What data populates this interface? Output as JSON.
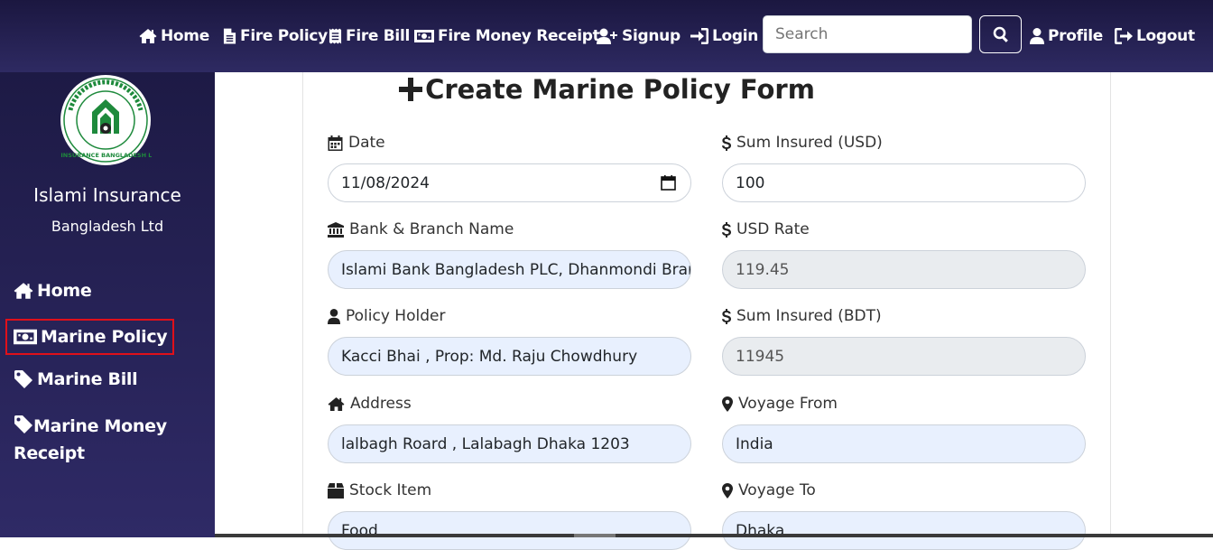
{
  "topnav": {
    "home": "Home",
    "fire_policy": "Fire Policy",
    "fire_bill": "Fire Bill",
    "fire_money_receipt": "Fire Money Receipt",
    "signup": "Signup",
    "login": "Login",
    "search_placeholder": "Search",
    "profile": "Profile",
    "logout": "Logout"
  },
  "sidebar": {
    "brand_name": "Islami Insurance",
    "brand_sub": "Bangladesh Ltd",
    "logo_text": "ISLAMI INSURANCE BANGLADESH LIMITED",
    "items": [
      {
        "label": "Home"
      },
      {
        "label": "Marine Policy"
      },
      {
        "label": "Marine Bill"
      },
      {
        "label": "Marine Money Receipt"
      }
    ]
  },
  "form": {
    "title": "Create Marine Policy Form",
    "date_label": "Date",
    "date_value": "11/08/2024",
    "sum_insured_usd_label": "Sum Insured (USD)",
    "sum_insured_usd_value": "100",
    "bank_label": "Bank & Branch Name",
    "bank_value": "Islami Bank Bangladesh PLC, Dhanmondi Branch",
    "usd_rate_label": "USD Rate",
    "usd_rate_value": "119.45",
    "policy_holder_label": "Policy Holder",
    "policy_holder_value": "Kacci Bhai , Prop: Md. Raju Chowdhury",
    "sum_insured_bdt_label": "Sum Insured (BDT)",
    "sum_insured_bdt_value": "11945",
    "address_label": "Address",
    "address_value": "lalbagh Roard , Lalabagh Dhaka 1203",
    "voyage_from_label": "Voyage From",
    "voyage_from_value": "India",
    "stock_item_label": "Stock Item",
    "stock_item_value": "Food",
    "voyage_to_label": "Voyage To",
    "voyage_to_value": "Dhaka"
  },
  "colors": {
    "nav_bg": "#1b1740",
    "sidebar_bg": "#2f2a66",
    "active_outline": "#e0101a",
    "autofill_bg": "#e8f0fe",
    "disabled_bg": "#e9ecef"
  }
}
